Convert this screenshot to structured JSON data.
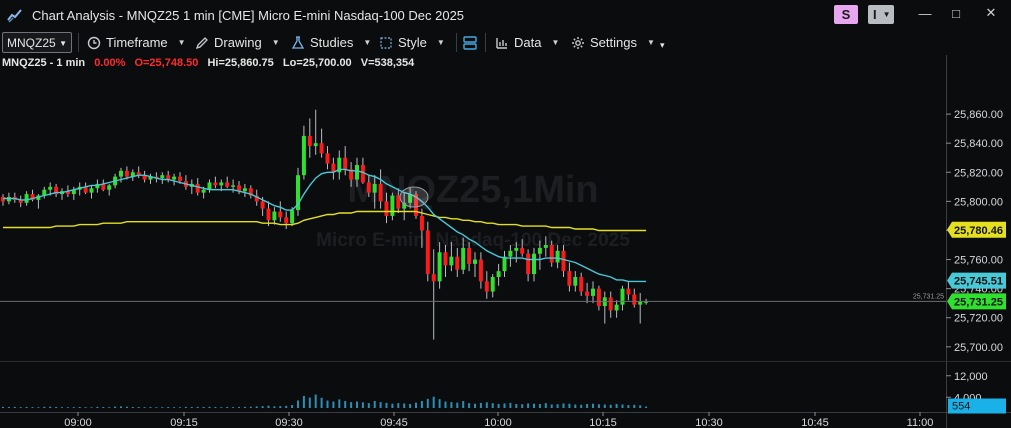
{
  "window": {
    "title": "Chart Analysis - MNQZ25 1 min [CME] Micro E-mini Nasdaq-100 Dec 2025",
    "badge_s": "S",
    "badge_i": "I",
    "minimize": "—",
    "maximize": "□",
    "close": "✕"
  },
  "toolbar": {
    "symbol": "MNQZ25",
    "timeframe": "Timeframe",
    "drawing": "Drawing",
    "studies": "Studies",
    "style": "Style",
    "data": "Data",
    "settings": "Settings"
  },
  "info": {
    "symbol_interval": "MNQZ25 - 1 min",
    "change": "0.00%",
    "open": "O=25,748.50",
    "high": "Hi=25,860.75",
    "low": "Lo=25,700.00",
    "volume": "V=538,354"
  },
  "watermark": {
    "line1": "MNQZ25,1Min",
    "line2": "Micro E-mini Nasdaq-100 Dec 2025"
  },
  "colors": {
    "up": "#2fe02f",
    "down": "#ff1a1a",
    "ema_short": "#48c9d8",
    "ema_long": "#e4e021",
    "volume": "#2b8fb5",
    "crosshair": "#6b6e73"
  },
  "chart_data": {
    "type": "candlestick",
    "price_axis_ticks": [
      "25,860.00",
      "25,840.00",
      "25,820.00",
      "25,800.00",
      "25,780.00",
      "25,760.00",
      "25,740.00",
      "25,720.00",
      "25,700.00"
    ],
    "price_axis_values": [
      25860,
      25840,
      25820,
      25800,
      25780,
      25760,
      25740,
      25720,
      25700
    ],
    "ylim": [
      25693,
      25880
    ],
    "time_axis_ticks": [
      "09:00",
      "09:15",
      "09:30",
      "09:45",
      "10:00",
      "10:15",
      "10:30",
      "10:45",
      "11:00"
    ],
    "volume_axis_ticks": [
      "12,000",
      "4,000"
    ],
    "volume_axis_values": [
      12000,
      4000
    ],
    "volume_ylim": [
      0,
      16000
    ],
    "price_labels": {
      "long_ma": "25,780.46",
      "short_ma": "25,745.51",
      "last_price": "25,731.25",
      "crosshair_price": "25,731.25",
      "last_volume": "554"
    },
    "last_price_value": 25731.25,
    "long_ma_value": 25780.46,
    "short_ma_value": 25745.51,
    "candles": [
      [
        25803,
        25805,
        25797,
        25800
      ],
      [
        25800,
        25806,
        25798,
        25803
      ],
      [
        25803,
        25806,
        25799,
        25801
      ],
      [
        25801,
        25804,
        25796,
        25799
      ],
      [
        25799,
        25807,
        25797,
        25805
      ],
      [
        25805,
        25808,
        25800,
        25801
      ],
      [
        25801,
        25805,
        25795,
        25804
      ],
      [
        25804,
        25810,
        25802,
        25808
      ],
      [
        25808,
        25813,
        25804,
        25810
      ],
      [
        25810,
        25812,
        25803,
        25805
      ],
      [
        25805,
        25809,
        25801,
        25807
      ],
      [
        25807,
        25811,
        25803,
        25805
      ],
      [
        25805,
        25810,
        25801,
        25808
      ],
      [
        25808,
        25813,
        25804,
        25810
      ],
      [
        25810,
        25813,
        25805,
        25806
      ],
      [
        25806,
        25811,
        25802,
        25809
      ],
      [
        25809,
        25815,
        25806,
        25812
      ],
      [
        25812,
        25815,
        25807,
        25808
      ],
      [
        25808,
        25812,
        25804,
        25811
      ],
      [
        25811,
        25819,
        25809,
        25817
      ],
      [
        25817,
        25823,
        25813,
        25821
      ],
      [
        25821,
        25824,
        25815,
        25817
      ],
      [
        25817,
        25822,
        25814,
        25820
      ],
      [
        25820,
        25824,
        25816,
        25818
      ],
      [
        25818,
        25821,
        25813,
        25815
      ],
      [
        25815,
        25819,
        25812,
        25817
      ],
      [
        25817,
        25820,
        25813,
        25816
      ],
      [
        25816,
        25820,
        25812,
        25818
      ],
      [
        25818,
        25821,
        25813,
        25815
      ],
      [
        25815,
        25819,
        25811,
        25817
      ],
      [
        25817,
        25820,
        25812,
        25814
      ],
      [
        25814,
        25818,
        25808,
        25810
      ],
      [
        25810,
        25815,
        25805,
        25812
      ],
      [
        25812,
        25816,
        25804,
        25806
      ],
      [
        25806,
        25810,
        25802,
        25808
      ],
      [
        25808,
        25815,
        25806,
        25813
      ],
      [
        25813,
        25817,
        25809,
        25811
      ],
      [
        25811,
        25815,
        25807,
        25813
      ],
      [
        25813,
        25817,
        25809,
        25810
      ],
      [
        25810,
        25815,
        25806,
        25811
      ],
      [
        25811,
        25814,
        25805,
        25807
      ],
      [
        25807,
        25812,
        25803,
        25809
      ],
      [
        25809,
        25811,
        25802,
        25804
      ],
      [
        25804,
        25808,
        25797,
        25800
      ],
      [
        25800,
        25803,
        25790,
        25795
      ],
      [
        25795,
        25800,
        25783,
        25787
      ],
      [
        25787,
        25796,
        25784,
        25793
      ],
      [
        25793,
        25800,
        25786,
        25789
      ],
      [
        25789,
        25793,
        25781,
        25785
      ],
      [
        25785,
        25796,
        25783,
        25794
      ],
      [
        25794,
        25823,
        25790,
        25818
      ],
      [
        25818,
        25852,
        25815,
        25845
      ],
      [
        25845,
        25857,
        25830,
        25838
      ],
      [
        25838,
        25863,
        25832,
        25840
      ],
      [
        25840,
        25850,
        25830,
        25833
      ],
      [
        25833,
        25838,
        25822,
        25826
      ],
      [
        25826,
        25830,
        25815,
        25820
      ],
      [
        25820,
        25835,
        25815,
        25830
      ],
      [
        25830,
        25838,
        25818,
        25822
      ],
      [
        25822,
        25827,
        25810,
        25815
      ],
      [
        25815,
        25830,
        25810,
        25825
      ],
      [
        25825,
        25830,
        25812,
        25813
      ],
      [
        25813,
        25818,
        25803,
        25806
      ],
      [
        25806,
        25818,
        25795,
        25812
      ],
      [
        25812,
        25822,
        25795,
        25800
      ],
      [
        25800,
        25806,
        25785,
        25790
      ],
      [
        25790,
        25806,
        25787,
        25804
      ],
      [
        25804,
        25809,
        25792,
        25795
      ],
      [
        25795,
        25806,
        25787,
        25799
      ],
      [
        25799,
        25810,
        25795,
        25805
      ],
      [
        25805,
        25807,
        25788,
        25790
      ],
      [
        25790,
        25795,
        25768,
        25780
      ],
      [
        25780,
        25786,
        25745,
        25750
      ],
      [
        25750,
        25767,
        25705,
        25745
      ],
      [
        25745,
        25772,
        25740,
        25765
      ],
      [
        25765,
        25770,
        25748,
        25756
      ],
      [
        25756,
        25772,
        25752,
        25762
      ],
      [
        25762,
        25768,
        25748,
        25753
      ],
      [
        25753,
        25775,
        25750,
        25768
      ],
      [
        25768,
        25772,
        25752,
        25757
      ],
      [
        25757,
        25765,
        25748,
        25760
      ],
      [
        25760,
        25765,
        25740,
        25745
      ],
      [
        25745,
        25752,
        25733,
        25738
      ],
      [
        25738,
        25750,
        25734,
        25748
      ],
      [
        25748,
        25757,
        25742,
        25752
      ],
      [
        25752,
        25766,
        25748,
        25762
      ],
      [
        25762,
        25770,
        25755,
        25766
      ],
      [
        25766,
        25772,
        25758,
        25768
      ],
      [
        25768,
        25774,
        25762,
        25764
      ],
      [
        25764,
        25767,
        25745,
        25750
      ],
      [
        25750,
        25768,
        25745,
        25764
      ],
      [
        25764,
        25773,
        25753,
        25768
      ],
      [
        25768,
        25776,
        25762,
        25770
      ],
      [
        25770,
        25773,
        25755,
        25758
      ],
      [
        25758,
        25770,
        25754,
        25766
      ],
      [
        25766,
        25770,
        25748,
        25752
      ],
      [
        25752,
        25758,
        25738,
        25742
      ],
      [
        25742,
        25752,
        25738,
        25748
      ],
      [
        25748,
        25751,
        25735,
        25738
      ],
      [
        25738,
        25744,
        25730,
        25735
      ],
      [
        25735,
        25745,
        25730,
        25740
      ],
      [
        25740,
        25742,
        25725,
        25728
      ],
      [
        25728,
        25738,
        25716,
        25734
      ],
      [
        25734,
        25738,
        25720,
        25725
      ],
      [
        25725,
        25732,
        25720,
        25729
      ],
      [
        25729,
        25742,
        25725,
        25740
      ],
      [
        25740,
        25745,
        25732,
        25736
      ],
      [
        25736,
        25740,
        25727,
        25729
      ],
      [
        25729,
        25737,
        25716,
        25731
      ],
      [
        25731,
        25733,
        25729,
        25731
      ]
    ],
    "volumes": [
      400,
      350,
      420,
      300,
      380,
      320,
      280,
      450,
      500,
      360,
      300,
      280,
      320,
      380,
      300,
      260,
      420,
      350,
      300,
      520,
      600,
      480,
      380,
      350,
      300,
      320,
      280,
      300,
      350,
      300,
      280,
      400,
      360,
      420,
      380,
      450,
      350,
      300,
      380,
      320,
      350,
      420,
      480,
      600,
      700,
      850,
      600,
      700,
      800,
      1100,
      2800,
      4500,
      3900,
      5000,
      3800,
      2800,
      2400,
      3200,
      2600,
      2200,
      2400,
      2100,
      1800,
      2600,
      2200,
      1900,
      1600,
      1800,
      1700,
      1500,
      2000,
      2600,
      3400,
      4200,
      3300,
      2400,
      2200,
      2000,
      2600,
      1800,
      1600,
      1900,
      2100,
      1800,
      1500,
      1700,
      1900,
      1500,
      1400,
      1700,
      1600,
      1500,
      1800,
      1300,
      1400,
      1700,
      1600,
      1300,
      1200,
      1500,
      1600,
      1400,
      1300,
      1200,
      1500,
      1300,
      1100,
      1200,
      1000,
      554
    ],
    "ema_short": [
      25802,
      25802,
      25802,
      25801,
      25801,
      25802,
      25803,
      25804,
      25805,
      25806,
      25806,
      25807,
      25808,
      25809,
      25810,
      25811,
      25811,
      25812,
      25813,
      25814,
      25815,
      25816,
      25817,
      25818,
      25818,
      25817,
      25816,
      25815,
      25815,
      25814,
      25813,
      25812,
      25811,
      25810,
      25809,
      25808,
      25808,
      25808,
      25808,
      25808,
      25807,
      25806,
      25805,
      25803,
      25801,
      25799,
      25797,
      25796,
      25794,
      25794,
      25798,
      25805,
      25811,
      25816,
      25819,
      25820,
      25820,
      25822,
      25822,
      25821,
      25821,
      25820,
      25818,
      25817,
      25815,
      25812,
      25810,
      25808,
      25806,
      25805,
      25803,
      25800,
      25796,
      25791,
      25788,
      25785,
      25782,
      25779,
      25777,
      25774,
      25772,
      25769,
      25766,
      25764,
      25762,
      25761,
      25761,
      25761,
      25761,
      25760,
      25760,
      25760,
      25761,
      25761,
      25761,
      25760,
      25759,
      25758,
      25756,
      25754,
      25752,
      25750,
      25749,
      25748,
      25746,
      25746,
      25745,
      25745,
      25745,
      25745
    ],
    "ema_long": [
      25782,
      25782,
      25782,
      25782,
      25782,
      25782,
      25782,
      25782,
      25782,
      25783,
      25783,
      25783,
      25783,
      25784,
      25784,
      25784,
      25784,
      25785,
      25785,
      25785,
      25785,
      25786,
      25786,
      25786,
      25786,
      25786,
      25786,
      25786,
      25786,
      25786,
      25786,
      25786,
      25786,
      25786,
      25786,
      25786,
      25786,
      25786,
      25786,
      25786,
      25786,
      25786,
      25786,
      25786,
      25785,
      25785,
      25785,
      25784,
      25784,
      25784,
      25785,
      25787,
      25788,
      25789,
      25790,
      25791,
      25791,
      25792,
      25792,
      25792,
      25793,
      25793,
      25793,
      25793,
      25793,
      25793,
      25793,
      25793,
      25793,
      25793,
      25793,
      25792,
      25791,
      25790,
      25789,
      25789,
      25788,
      25788,
      25787,
      25787,
      25786,
      25786,
      25785,
      25785,
      25784,
      25784,
      25784,
      25784,
      25783,
      25783,
      25783,
      25783,
      25783,
      25782,
      25782,
      25782,
      25782,
      25781,
      25781,
      25781,
      25781,
      25780,
      25780,
      25780,
      25780,
      25780,
      25780,
      25780,
      25780,
      25780
    ]
  }
}
